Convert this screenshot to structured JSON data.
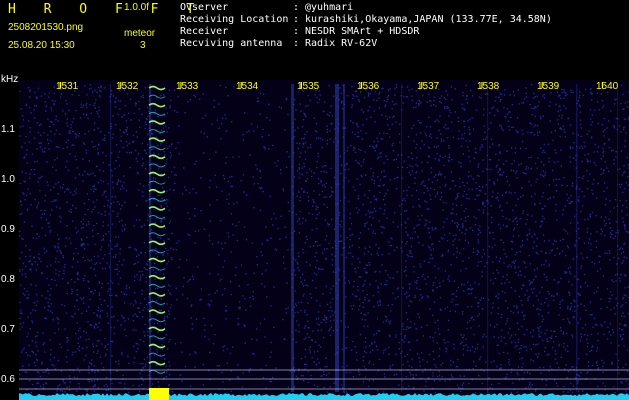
{
  "header": {
    "brand": "H R O F F T",
    "version": "1.0.0f",
    "filename": "2508201530.png",
    "mode": "meteor",
    "datetime": "25.08.20 15:30",
    "count": "3",
    "info_rows": [
      {
        "label": "Ovserver",
        "value": "@yuhmari"
      },
      {
        "label": "Receiving Location",
        "value": "kurashiki,Okayama,JAPAN (133.77E, 34.58N)"
      },
      {
        "label": "Receiver",
        "value": "NESDR SMArt + HDSDR"
      },
      {
        "label": "Recviving antenna",
        "value": "Radix RV-62V"
      }
    ]
  },
  "spectrogram": {
    "x_unit": "Hz",
    "x_ticks": [
      "1531",
      "1532",
      "1533",
      "1534",
      "1535",
      "1536",
      "1537",
      "1538",
      "1539",
      "1540"
    ],
    "y_unit": "kHz",
    "y_ticks": [
      "1.1",
      "1.0",
      "0.9",
      "0.8",
      "0.7",
      "0.6"
    ],
    "colors": {
      "background": "#030018",
      "noise": "#2a3aa8",
      "signal": "#9fff6a",
      "trace": "#22d8ff",
      "ticks": "#ffff00"
    }
  }
}
